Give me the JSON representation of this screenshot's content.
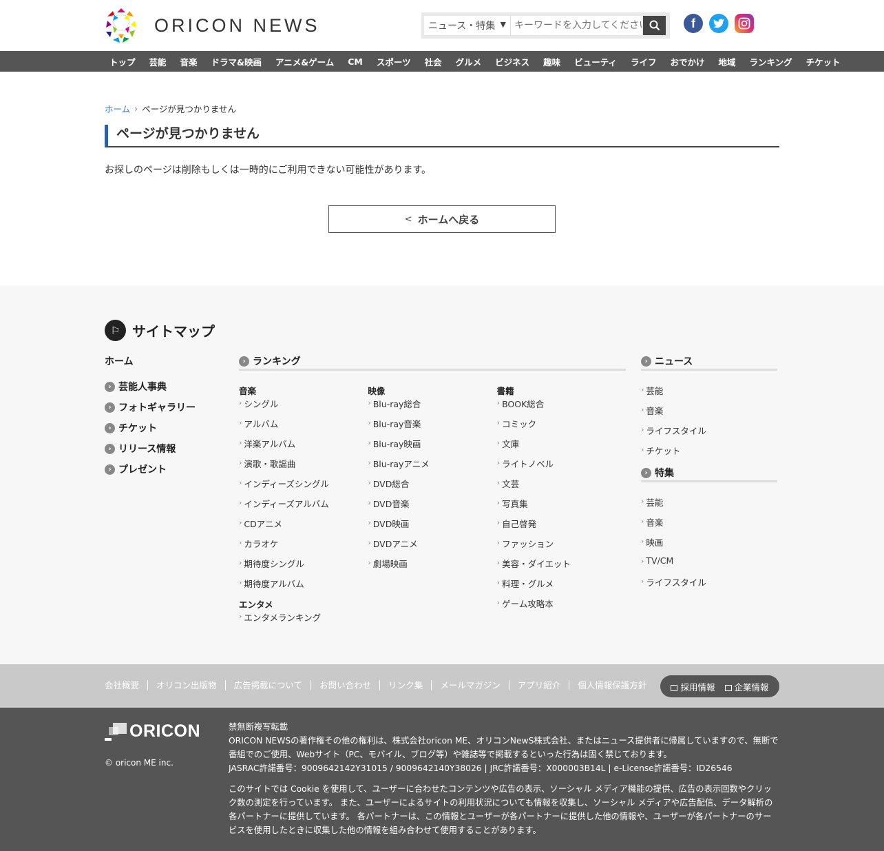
{
  "header": {
    "logo_text": "ORICON NEWS",
    "search": {
      "category": "ニュース・特集",
      "placeholder": "キーワードを入力してください"
    }
  },
  "nav": [
    "トップ",
    "芸能",
    "音楽",
    "ドラマ&映画",
    "アニメ&ゲーム",
    "CM",
    "スポーツ",
    "社会",
    "グルメ",
    "ビジネス",
    "趣味",
    "ビューティ",
    "ライフ",
    "おでかけ",
    "地域",
    "ランキング",
    "チケット"
  ],
  "breadcrumb": {
    "home": "ホーム",
    "current": "ページが見つかりません"
  },
  "main": {
    "title": "ページが見つかりません",
    "message": "お探しのページは削除もしくは一時的にご利用できない可能性があります。",
    "back_button": "ホームへ戻る"
  },
  "sitemap": {
    "title": "サイトマップ",
    "home": "ホーム",
    "left_items": [
      "芸能人事典",
      "フォトギャラリー",
      "チケット",
      "リリース情報",
      "プレゼント"
    ],
    "ranking": {
      "heading": "ランキング",
      "music": {
        "head": "音楽",
        "links": [
          "シングル",
          "アルバム",
          "洋楽アルバム",
          "演歌・歌謡曲",
          "インディーズシングル",
          "インディーズアルバム",
          "CDアニメ",
          "カラオケ",
          "期待度シングル",
          "期待度アルバム"
        ]
      },
      "entame": {
        "head": "エンタメ",
        "links": [
          "エンタメランキング"
        ]
      },
      "video": {
        "head": "映像",
        "links": [
          "Blu-ray総合",
          "Blu-ray音楽",
          "Blu-ray映画",
          "Blu-rayアニメ",
          "DVD総合",
          "DVD音楽",
          "DVD映画",
          "DVDアニメ",
          "劇場映画"
        ]
      },
      "books": {
        "head": "書籍",
        "links": [
          "BOOK総合",
          "コミック",
          "文庫",
          "ライトノベル",
          "文芸",
          "写真集",
          "自己啓発",
          "ファッション",
          "美容・ダイエット",
          "料理・グルメ",
          "ゲーム攻略本"
        ]
      }
    },
    "news": {
      "heading": "ニュース",
      "links": [
        "芸能",
        "音楽",
        "ライフスタイル",
        "チケット"
      ]
    },
    "special": {
      "heading": "特集",
      "links": [
        "芸能",
        "音楽",
        "映画",
        "TV/CM",
        "ライフスタイル"
      ]
    }
  },
  "footer": {
    "links": [
      "会社概要",
      "オリコン出版物",
      "広告掲載について",
      "お問い合わせ",
      "リンク集",
      "メールマガジン",
      "アプリ紹介",
      "個人情報保護方針"
    ],
    "corp": [
      "採用情報",
      "企業情報"
    ],
    "logo_text": "ORICON",
    "copyright": "© oricon ME inc.",
    "legal": [
      "禁無断複写転載",
      "ORICON NEWSの著作権その他の権利は、株式会社oricon ME、オリコンNewS株式会社、またはニュース提供者に帰属していますので、無断で番組でのご使用、Webサイト（PC、モバイル、ブログ等）や雑誌等で掲載するといった行為は固く禁じております。",
      "JASRAC許諾番号：9009642142Y31015 / 9009642140Y38026 | JRC許諾番号：X000003B14L | e-License許諾番号：ID26546"
    ],
    "cookie": "このサイトでは Cookie を使用して、ユーザーに合わせたコンテンツや広告の表示、ソーシャル メディア機能の提供、広告の表示回数やクリック数の測定を行っています。 また、ユーザーによるサイトの利用状況についても情報を収集し、ソーシャル メディアや広告配信、データ解析の各パートナーに提供しています。 各パートナーは、この情報とユーザーが各パートナーに提供した他の情報や、ユーザーが各パートナーのサービスを使用したときに収集した他の情報を組み合わせて使用することがあります。"
  }
}
